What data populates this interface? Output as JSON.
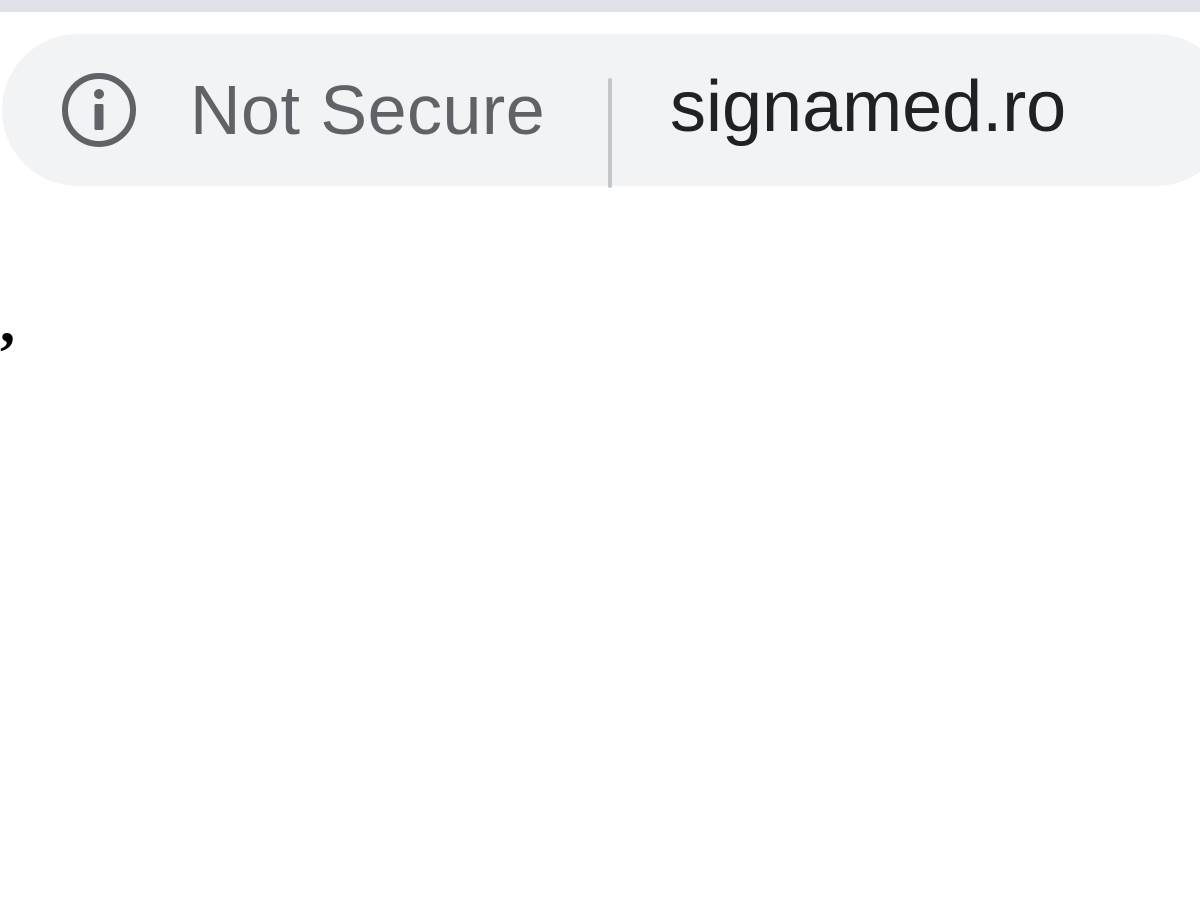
{
  "browser": {
    "omnibox": {
      "security_icon": "info-circle-icon",
      "security_label": "Not Secure",
      "url": "signamed.ro"
    }
  },
  "page": {
    "visible_text": ","
  },
  "colors": {
    "omnibox_background": "#f1f3f4",
    "security_text": "#5f6368",
    "url_text": "#202124",
    "top_strip": "#dee1e6"
  }
}
